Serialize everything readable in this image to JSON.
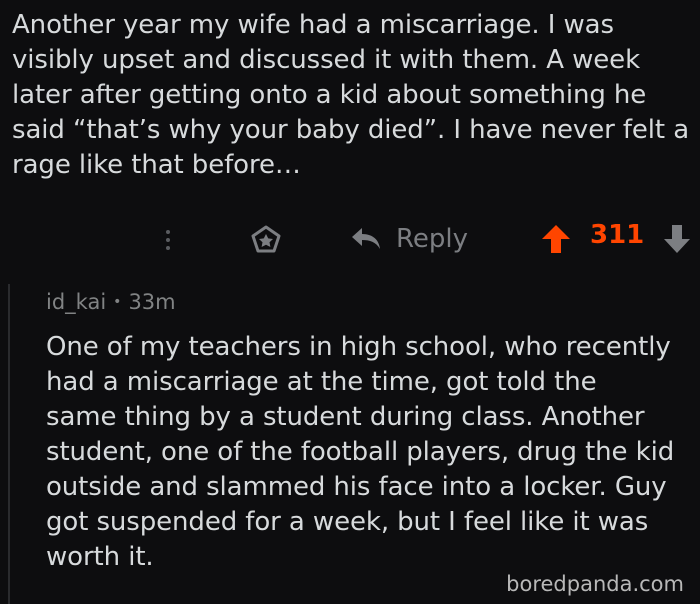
{
  "parent_comment": {
    "body": "Another year my wife had a miscarriage. I was\nvisibly upset and discussed it with them. A week\nlater after getting onto a kid about something he\nsaid “that’s why your baby died”. I have never felt a\nrage like that before…"
  },
  "actions": {
    "more_icon": "more-vertical-icon",
    "award_icon": "award-icon",
    "reply_icon": "reply-arrow-icon",
    "reply_label": "Reply",
    "upvote_icon": "upvote-arrow-icon",
    "score": "311",
    "downvote_icon": "downvote-arrow-icon",
    "score_color": "#ff4500"
  },
  "reply_comment": {
    "author": "id_kai",
    "separator": "•",
    "time": "33m",
    "body": "One of my teachers in high school, who recently\nhad a miscarriage at the time, got told the\nsame thing by a student during class. Another\nstudent, one of the football players, drug the kid\noutside and slammed his face into a locker. Guy\ngot suspended for a week, but I feel like it was\nworth it."
  },
  "watermark": "boredpanda.com"
}
